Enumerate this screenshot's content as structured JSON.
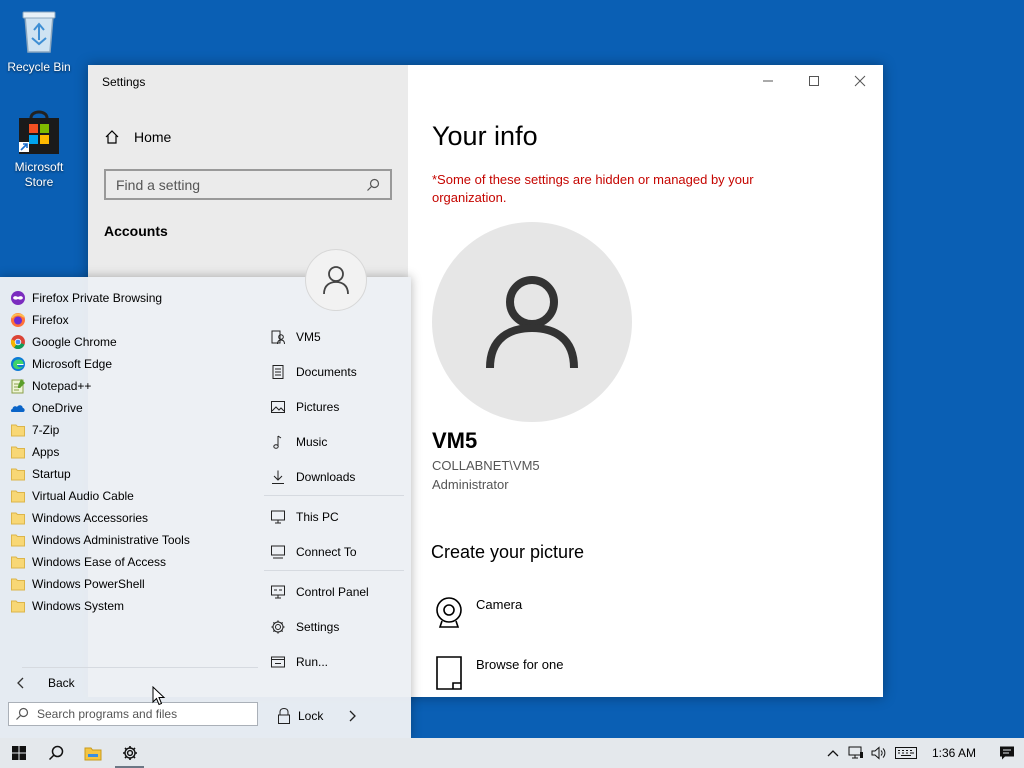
{
  "desktop": {
    "recycle_bin": "Recycle Bin",
    "store": "Microsoft Store"
  },
  "settings": {
    "window_title": "Settings",
    "home": "Home",
    "search_placeholder": "Find a setting",
    "section": "Accounts",
    "page_title": "Your info",
    "warning": "*Some of these settings are hidden or managed by your organization.",
    "user_name": "VM5",
    "user_domain": "COLLABNET\\VM5",
    "user_role": "Administrator",
    "create_picture": "Create your picture",
    "camera": "Camera",
    "browse": "Browse for one"
  },
  "start_menu": {
    "programs": [
      {
        "label": "Firefox Private Browsing",
        "icon": "firefox-private-icon"
      },
      {
        "label": "Firefox",
        "icon": "firefox-icon"
      },
      {
        "label": "Google Chrome",
        "icon": "chrome-icon"
      },
      {
        "label": "Microsoft Edge",
        "icon": "edge-icon"
      },
      {
        "label": "Notepad++",
        "icon": "notepadpp-icon"
      },
      {
        "label": "OneDrive",
        "icon": "onedrive-icon"
      },
      {
        "label": "7-Zip",
        "icon": "folder-icon"
      },
      {
        "label": "Apps",
        "icon": "folder-icon"
      },
      {
        "label": "Startup",
        "icon": "folder-icon"
      },
      {
        "label": "Virtual Audio Cable",
        "icon": "folder-icon"
      },
      {
        "label": "Windows Accessories",
        "icon": "folder-icon"
      },
      {
        "label": "Windows Administrative Tools",
        "icon": "folder-icon"
      },
      {
        "label": "Windows Ease of Access",
        "icon": "folder-icon"
      },
      {
        "label": "Windows PowerShell",
        "icon": "folder-icon"
      },
      {
        "label": "Windows System",
        "icon": "folder-icon"
      }
    ],
    "back": "Back",
    "search_placeholder": "Search programs and files",
    "places": {
      "user": "VM5",
      "documents": "Documents",
      "pictures": "Pictures",
      "music": "Music",
      "downloads": "Downloads",
      "this_pc": "This PC",
      "connect_to": "Connect To",
      "control_panel": "Control Panel",
      "settings": "Settings",
      "run": "Run..."
    },
    "lock": "Lock"
  },
  "taskbar": {
    "clock": "1:36 AM"
  }
}
